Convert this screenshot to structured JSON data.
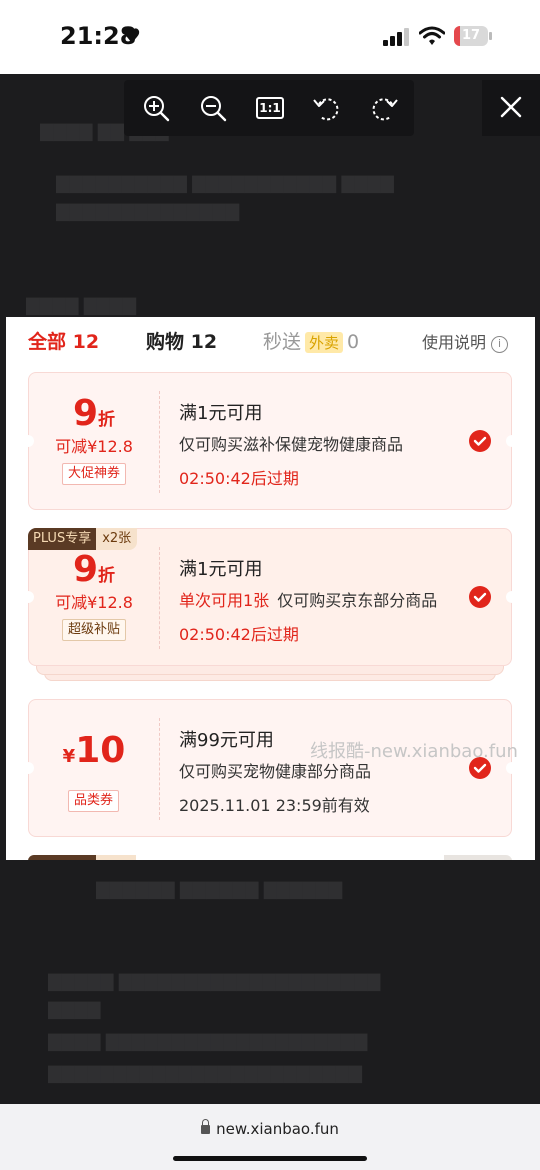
{
  "status_bar": {
    "time": "21:28",
    "battery_level": 17,
    "heart_icon": "heart-icon",
    "icons": [
      "signal-icon",
      "wifi-icon",
      "battery-icon"
    ]
  },
  "viewer_toolbar": {
    "tools": [
      "zoom-in-icon",
      "zoom-out-icon",
      "actual-size-icon",
      "rotate-left-icon",
      "rotate-right-icon"
    ],
    "actual_size_label": "1:1",
    "close_icon": "close-icon"
  },
  "coupon_screen": {
    "tabs": {
      "all": "全部 12",
      "shopping": "购物 12",
      "fast_prefix": "秒送",
      "fast_tag": "外卖",
      "fast_count": "0"
    },
    "help_label": "使用说明",
    "help_icon_glyph": "i",
    "coupons": [
      {
        "discount_value": "9",
        "discount_unit": "折",
        "reduce": "可减¥12.8",
        "tag": "大促神券",
        "title": "满1元可用",
        "desc": "仅可购买滋补保健宠物健康商品",
        "expire": "02:50:42后过期",
        "selected": true
      },
      {
        "plus_badge": "PLUS专享",
        "count_badge": "x2张",
        "discount_value": "9",
        "discount_unit": "折",
        "reduce": "可减¥12.8",
        "tag": "超级补贴",
        "title": "满1元可用",
        "desc_highlight": "单次可用1张",
        "desc": "仅可购买京东部分商品",
        "expire": "02:50:42后过期",
        "selected": true
      },
      {
        "currency": "¥",
        "amount": "10",
        "tag": "品类券",
        "title": "满99元可用",
        "desc": "仅可购买宠物健康部分商品",
        "expire": "2025.11.01 23:59前有效",
        "selected": true
      }
    ],
    "watermark": "线报酷-new.xianbao.fun"
  },
  "url_bar": {
    "url": "new.xianbao.fun",
    "lock_icon": "lock-icon"
  },
  "colors": {
    "accent_red": "#e1251b",
    "viewer_bg": "#1c1c1e",
    "plus_brown": "#5a3a24"
  }
}
